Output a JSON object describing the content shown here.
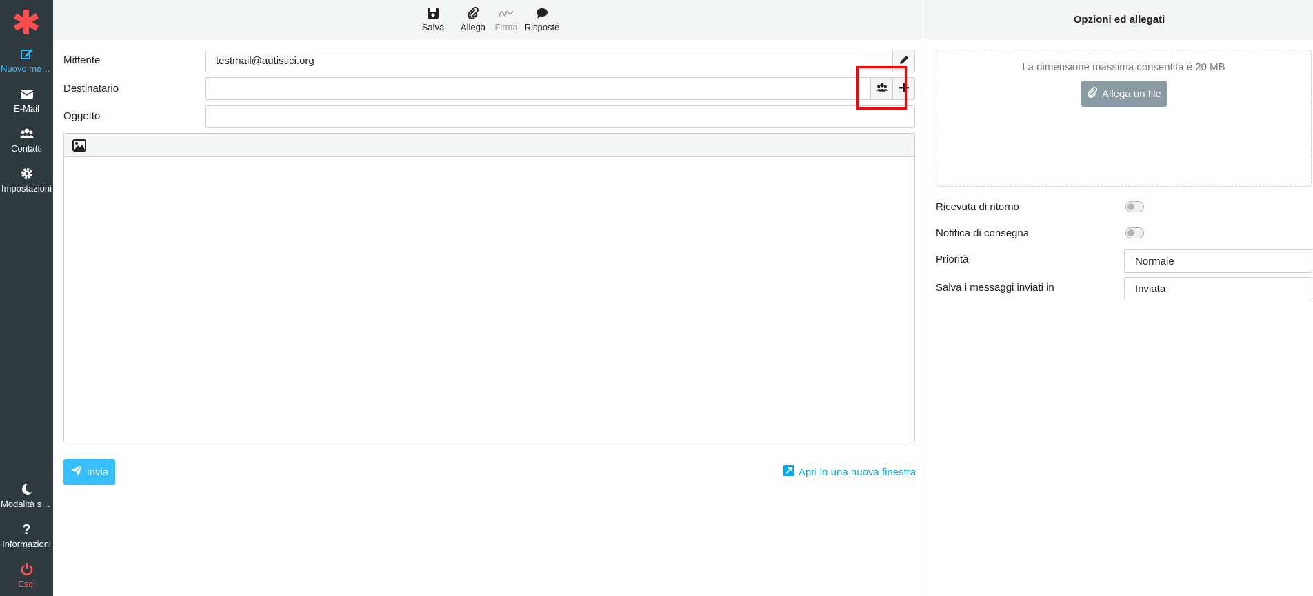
{
  "sidebar": {
    "items": [
      {
        "label": "Nuovo mes...",
        "icon": "compose-icon"
      },
      {
        "label": "E-Mail",
        "icon": "envelope-icon"
      },
      {
        "label": "Contatti",
        "icon": "users-icon"
      },
      {
        "label": "Impostazioni",
        "icon": "gear-icon"
      }
    ],
    "bottom": [
      {
        "label": "Modalità sc...",
        "icon": "moon-icon"
      },
      {
        "label": "Informazioni",
        "icon": "question-icon"
      },
      {
        "label": "Esci",
        "icon": "power-icon"
      }
    ]
  },
  "toolbar": {
    "save": "Salva",
    "attach": "Allega",
    "signature": "Firma",
    "responses": "Risposte"
  },
  "form": {
    "from_label": "Mittente",
    "from_value": "testmail@autistici.org",
    "to_label": "Destinatario",
    "to_value": "",
    "subject_label": "Oggetto",
    "subject_value": ""
  },
  "actions": {
    "send": "Invia",
    "open_new_window": "Apri in una nuova finestra"
  },
  "options": {
    "title": "Opzioni ed allegati",
    "max_size": "La dimensione massima consentita è 20 MB",
    "attach_file": "Allega un file",
    "read_receipt": "Ricevuta di ritorno",
    "delivery_notice": "Notifica di consegna",
    "priority_label": "Priorità",
    "priority_value": "Normale",
    "save_sent_label": "Salva i messaggi inviati in",
    "save_sent_value": "Inviata"
  },
  "colors": {
    "accent": "#37beff",
    "logo": "#ff4d4d",
    "sidebar_bg": "#2f3a3f",
    "highlight": "#ff0000"
  }
}
